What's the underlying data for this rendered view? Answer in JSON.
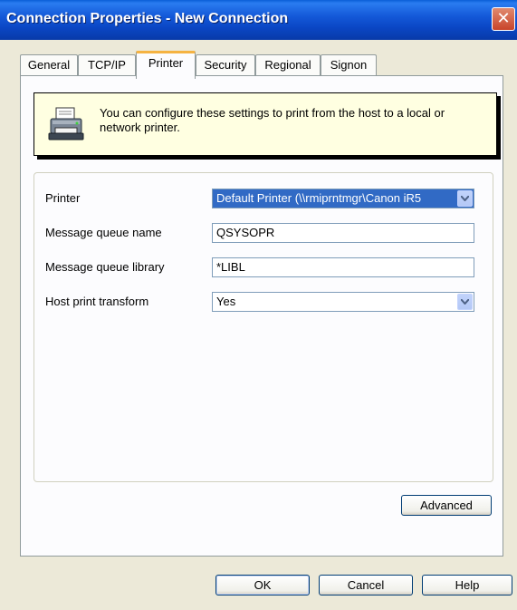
{
  "window": {
    "title": "Connection Properties - New Connection",
    "close_glyph": "✕"
  },
  "tabs": [
    {
      "label": "General",
      "active": false
    },
    {
      "label": "TCP/IP",
      "active": false
    },
    {
      "label": "Printer",
      "active": true
    },
    {
      "label": "Security",
      "active": false
    },
    {
      "label": "Regional",
      "active": false
    },
    {
      "label": "Signon",
      "active": false
    }
  ],
  "info": {
    "icon": "printer-icon",
    "text": "You can configure these settings to print from the host to a local or network printer."
  },
  "form": {
    "printer_label": "Printer",
    "printer_value": "Default Printer (\\\\rmiprntmgr\\Canon iR5",
    "mq_name_label": "Message queue name",
    "mq_name_value": "QSYSOPR",
    "mq_library_label": "Message queue library",
    "mq_library_value": "*LIBL",
    "transform_label": "Host print transform",
    "transform_value": "Yes"
  },
  "buttons": {
    "advanced": "Advanced",
    "ok": "OK",
    "cancel": "Cancel",
    "help": "Help"
  }
}
